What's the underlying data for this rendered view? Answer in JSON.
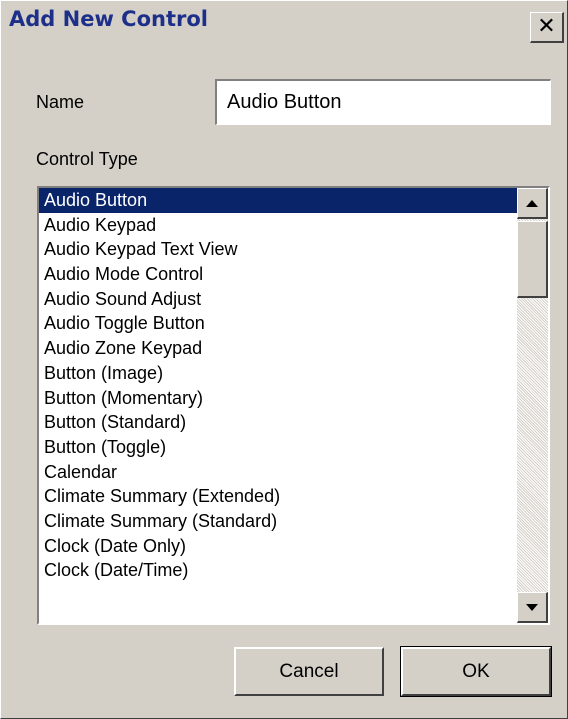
{
  "window": {
    "title": "Add New Control"
  },
  "icons": {
    "close": "close-icon",
    "scroll_up": "arrow-up-icon",
    "scroll_down": "arrow-down-icon"
  },
  "colors": {
    "title_text": "#1d2f88",
    "selection": "#0a246a",
    "dialog_bg": "#d4d0c8"
  },
  "form": {
    "name_label": "Name",
    "name_value": "Audio Button",
    "control_type_label": "Control Type"
  },
  "list": {
    "selected_index": 0,
    "items": [
      "Audio Button",
      "Audio Keypad",
      "Audio Keypad Text View",
      "Audio Mode Control",
      "Audio Sound Adjust",
      "Audio Toggle Button",
      "Audio Zone Keypad",
      "Button (Image)",
      "Button (Momentary)",
      "Button (Standard)",
      "Button (Toggle)",
      "Calendar",
      "Climate Summary (Extended)",
      "Climate Summary (Standard)",
      "Clock (Date Only)",
      "Clock (Date/Time)"
    ]
  },
  "buttons": {
    "cancel_label": "Cancel",
    "ok_label": "OK"
  }
}
